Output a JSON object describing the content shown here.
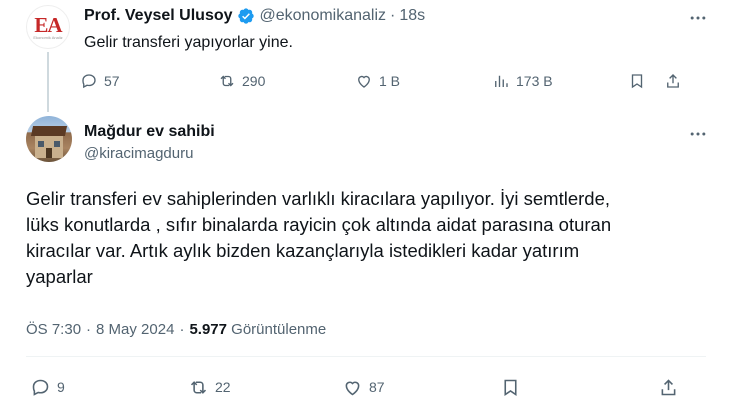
{
  "parent_tweet": {
    "avatar_logo": "EA",
    "avatar_logo_sub": "Ekonomik Analiz",
    "name": "Prof. Veysel Ulusoy",
    "handle": "@ekonomikanaliz",
    "dot": "·",
    "time": "18s",
    "text": "Gelir transferi yapıyorlar yine.",
    "actions": {
      "replies": "57",
      "retweets": "290",
      "likes": "1 B",
      "views": "173 B"
    },
    "icons": [
      "verified-badge-icon",
      "more-icon",
      "reply-icon",
      "retweet-icon",
      "like-icon",
      "views-icon",
      "bookmark-icon",
      "share-icon"
    ],
    "colors": {
      "verified": "#1d9bf0",
      "logo": "#c62828"
    }
  },
  "main_tweet": {
    "name": "Mağdur ev sahibi",
    "handle": "@kiracimagduru",
    "text": "Gelir transferi ev sahiplerinden varlıklı kiracılara yapılıyor. İyi semtlerde,\nlüks konutlarda , sıfır binalarda rayicin çok altında aidat parasına oturan\nkiracılar var. Artık aylık bizden kazançlarıyla istedikleri kadar yatırım\nyaparlar",
    "meta": {
      "time": "ÖS 7:30",
      "sep": "·",
      "date": "8 May 2024",
      "views_count": "5.977",
      "views_label": "Görüntülenme"
    },
    "actions": {
      "replies": "9",
      "retweets": "22",
      "likes": "87"
    },
    "icons": [
      "more-icon",
      "reply-icon",
      "retweet-icon",
      "like-icon",
      "bookmark-icon",
      "share-icon"
    ],
    "colors": {
      "text": "#0f1419",
      "secondary": "#536471",
      "divider": "#eff3f4"
    }
  }
}
